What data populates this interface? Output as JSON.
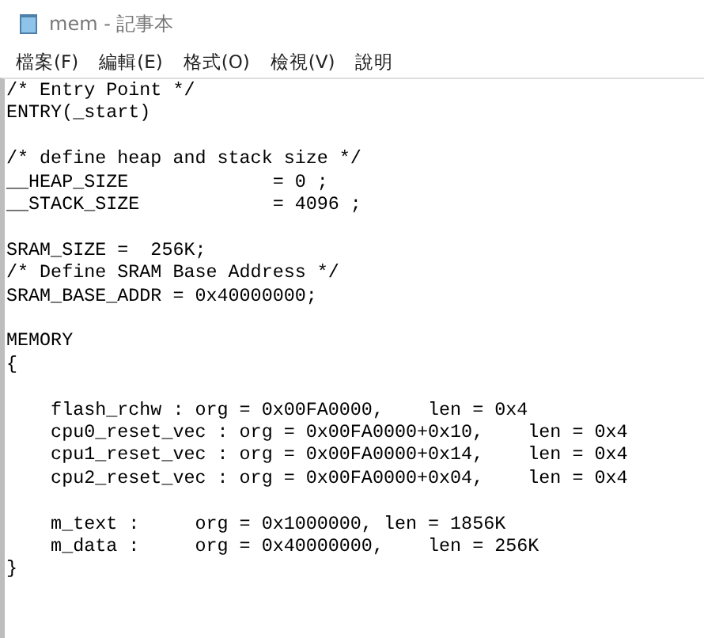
{
  "window": {
    "title": "mem - 記事本"
  },
  "menu": [
    "檔案(F)",
    "編輯(E)",
    "格式(O)",
    "檢視(V)",
    "說明"
  ],
  "editor": {
    "blocks": [
      [
        "/* Entry Point */",
        "ENTRY(_start)"
      ],
      [
        "/* define heap and stack size */",
        "__HEAP_SIZE             = 0 ;",
        "__STACK_SIZE            = 4096 ;"
      ],
      [
        "SRAM_SIZE =  256K;",
        "/* Define SRAM Base Address */",
        "SRAM_BASE_ADDR = 0x40000000;"
      ],
      [
        "MEMORY",
        "{"
      ],
      [
        "    flash_rchw : org = 0x00FA0000,    len = 0x4",
        "    cpu0_reset_vec : org = 0x00FA0000+0x10,    len = 0x4",
        "    cpu1_reset_vec : org = 0x00FA0000+0x14,    len = 0x4",
        "    cpu2_reset_vec : org = 0x00FA0000+0x04,    len = 0x4"
      ],
      [
        "    m_text :     org = 0x1000000, len = 1856K",
        "    m_data :     org = 0x40000000,    len = 256K",
        "}"
      ]
    ]
  }
}
